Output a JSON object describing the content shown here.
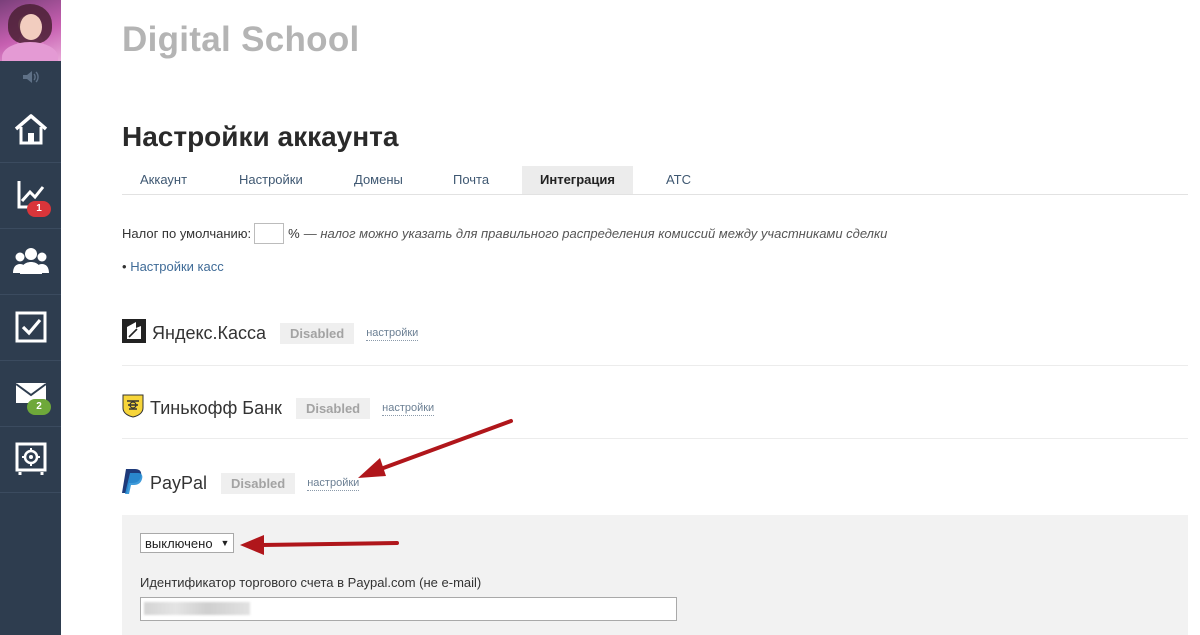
{
  "sidebar": {
    "items": [
      {
        "name": "home-icon"
      },
      {
        "name": "chart-icon",
        "badge": "1",
        "badge_color": "#d9353a"
      },
      {
        "name": "users-icon"
      },
      {
        "name": "checkbox-icon"
      },
      {
        "name": "mail-icon",
        "badge": "2",
        "badge_color": "#6ea83a"
      },
      {
        "name": "settings-safe-icon"
      }
    ]
  },
  "header": {
    "brand": "Digital School",
    "page_title": "Настройки аккаунта"
  },
  "tabs": [
    {
      "label": "Аккаунт"
    },
    {
      "label": "Настройки"
    },
    {
      "label": "Домены"
    },
    {
      "label": "Почта"
    },
    {
      "label": "Интеграция",
      "active": true
    },
    {
      "label": "АТС"
    }
  ],
  "tax": {
    "label": "Налог по умолчанию:",
    "value": "",
    "unit": "%",
    "note": "— налог можно указать для правильного распределения комиссий между участниками сделки"
  },
  "kassa_link": {
    "bullet": "•",
    "label": "Настройки касс"
  },
  "providers": [
    {
      "name": "Яндекс.Касса",
      "status": "Disabled",
      "settings_label": "настройки"
    },
    {
      "name": "Тинькофф Банк",
      "status": "Disabled",
      "settings_label": "настройки"
    },
    {
      "name": "PayPal",
      "status": "Disabled",
      "settings_label": "настройки"
    }
  ],
  "paypal_panel": {
    "select_value": "выключено",
    "field_label": "Идентификатор торгового счета в Paypal.com (не e-mail)"
  },
  "colors": {
    "sidebar_bg": "#2e3d4f",
    "annotation_arrow": "#b0161b",
    "badge_red": "#d9353a",
    "badge_green": "#6ea83a"
  }
}
